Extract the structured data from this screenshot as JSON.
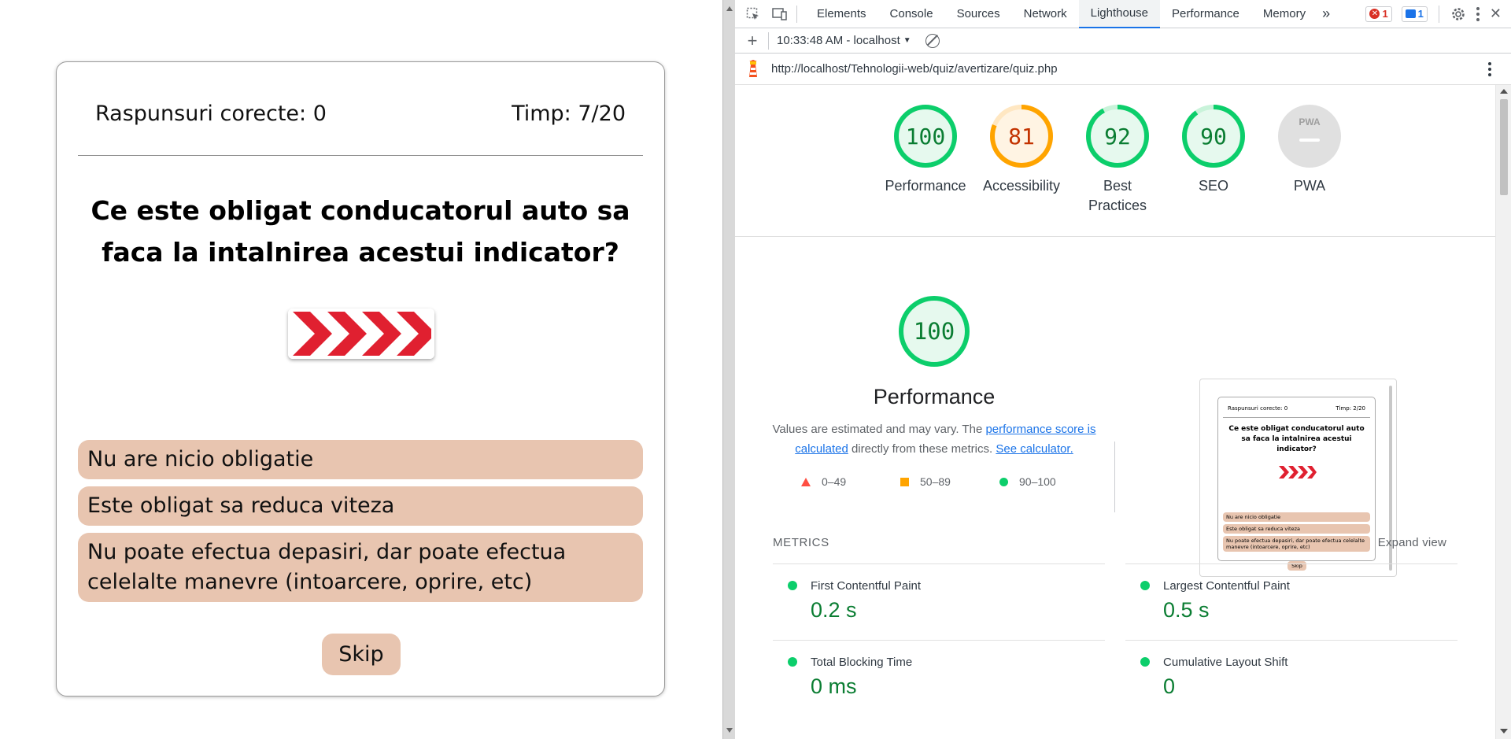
{
  "quiz": {
    "correct_label": "Raspunsuri corecte: 0",
    "time_label": "Timp: 7/20",
    "question": "Ce este obligat conducatorul auto sa faca la intalnirea acestui indicator?",
    "answers": [
      "Nu are nicio obligatie",
      "Este obligat sa reduca viteza",
      "Nu poate efectua depasiri, dar poate efectua celelalte manevre (intoarcere, oprire, etc)"
    ],
    "skip_label": "Skip",
    "colors": {
      "answer_bg": "#e8c5b0",
      "sign_red": "#e02030"
    }
  },
  "devtools": {
    "tabs": [
      "Elements",
      "Console",
      "Sources",
      "Network",
      "Lighthouse",
      "Performance",
      "Memory"
    ],
    "active_tab": "Lighthouse",
    "more_label": "»",
    "error_count": "1",
    "message_count": "1",
    "report_selector": "10:33:48 AM - localhost",
    "url": "http://localhost/Tehnologii-web/quiz/avertizare/quiz.php",
    "scores": [
      {
        "label": "Performance",
        "value": 100,
        "color": "#0cce6b",
        "text_color": "#0a7d32"
      },
      {
        "label": "Accessibility",
        "value": 81,
        "color": "#ffa400",
        "text_color": "#c33300"
      },
      {
        "label": "Best Practices",
        "value": 92,
        "color": "#0cce6b",
        "text_color": "#0a7d32"
      },
      {
        "label": "SEO",
        "value": 90,
        "color": "#0cce6b",
        "text_color": "#0a7d32"
      },
      {
        "label": "PWA",
        "value": null,
        "color": "#9e9e9e",
        "text_color": "#9e9e9e"
      }
    ],
    "pwa_badge": "PWA",
    "perf": {
      "value": "100",
      "title": "Performance",
      "note_prefix": "Values are estimated and may vary. The ",
      "note_link1": "performance score is calculated",
      "note_mid": " directly from these metrics. ",
      "note_link2": "See calculator.",
      "legend": [
        "0–49",
        "50–89",
        "90–100"
      ]
    },
    "thumbnail": {
      "correct": "Raspunsuri corecte: 0",
      "time": "Timp: 2/20",
      "question": "Ce este obligat conducatorul auto sa faca la intalnirea acestui indicator?",
      "answers": [
        "Nu are nicio obligatie",
        "Este obligat sa reduca viteza",
        "Nu poate efectua depasiri, dar poate efectua celelalte manevre (intoarcere, oprire, etc)"
      ],
      "skip": "Skip"
    },
    "metrics_label": "METRICS",
    "expand_label": "Expand view",
    "metrics": [
      {
        "name": "First Contentful Paint",
        "value": "0.2 s"
      },
      {
        "name": "Largest Contentful Paint",
        "value": "0.5 s"
      },
      {
        "name": "Total Blocking Time",
        "value": "0 ms"
      },
      {
        "name": "Cumulative Layout Shift",
        "value": "0"
      }
    ]
  }
}
